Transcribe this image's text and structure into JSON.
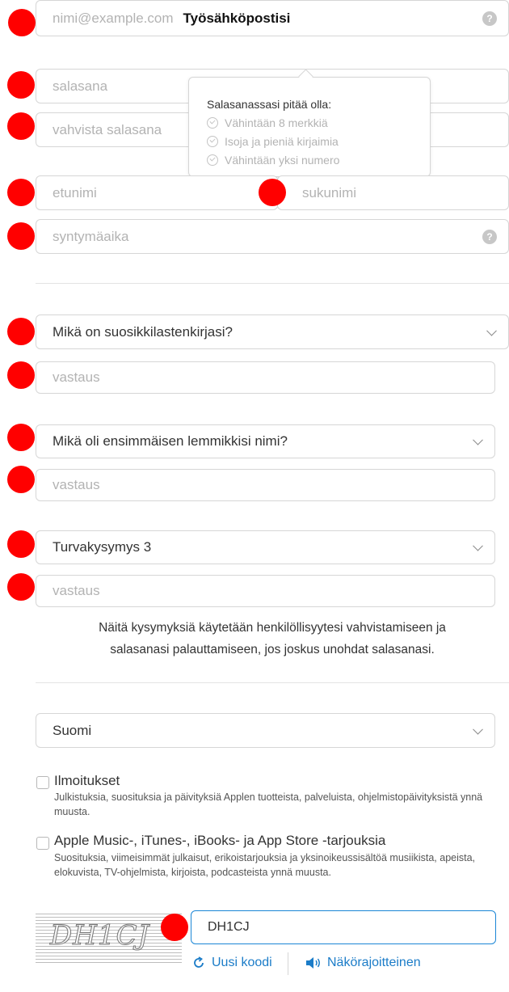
{
  "email": {
    "placeholder": "nimi@example.com",
    "label": "Työsähköpostisi",
    "help": "?"
  },
  "password": {
    "placeholder": "salasana"
  },
  "confirm_password": {
    "placeholder": "vahvista salasana"
  },
  "password_tooltip": {
    "title": "Salasanassasi pitää olla:",
    "rules": [
      "Vähintään 8 merkkiä",
      "Isoja ja pieniä kirjaimia",
      "Vähintään yksi numero"
    ]
  },
  "first_name": {
    "placeholder": "etunimi"
  },
  "last_name": {
    "placeholder": "sukunimi"
  },
  "birthdate": {
    "placeholder": "syntymäaika",
    "help": "?"
  },
  "security": [
    {
      "question": "Mikä on suosikkilastenkirjasi?",
      "answer_placeholder": "vastaus"
    },
    {
      "question": "Mikä oli ensimmäisen lemmikkisi nimi?",
      "answer_placeholder": "vastaus"
    },
    {
      "question": "Turvakysymys 3",
      "answer_placeholder": "vastaus"
    }
  ],
  "security_note": {
    "line1": "Näitä kysymyksiä käytetään henkilöllisyytesi vahvistamiseen ja",
    "line2": "salasanasi palauttamiseen, jos joskus unohdat salasanasi."
  },
  "language": {
    "selected": "Suomi"
  },
  "subscriptions": [
    {
      "title": "Ilmoitukset",
      "description": "Julkistuksia, suosituksia ja päivityksiä Applen tuotteista, palveluista, ohjelmistopäivityksistä ynnä muusta.",
      "checked": false
    },
    {
      "title": "Apple Music-, iTunes-, iBooks- ja App Store -tarjouksia",
      "description": "Suosituksia, viimeisimmät julkaisut, erikoistarjouksia ja yksinoikeussisältöä musiikista, apeista, elokuvista, TV-ohjelmista, kirjoista, podcasteista ynnä muusta.",
      "checked": false
    }
  ],
  "captcha": {
    "image_text": "DH1CJ",
    "input_value": "DH1CJ",
    "new_code_label": "Uusi koodi",
    "audio_label": "Näkörajoitteinen"
  },
  "colors": {
    "accent": "#1b7cc8",
    "marker": "#ff0000",
    "border": "#d6d6d6"
  }
}
